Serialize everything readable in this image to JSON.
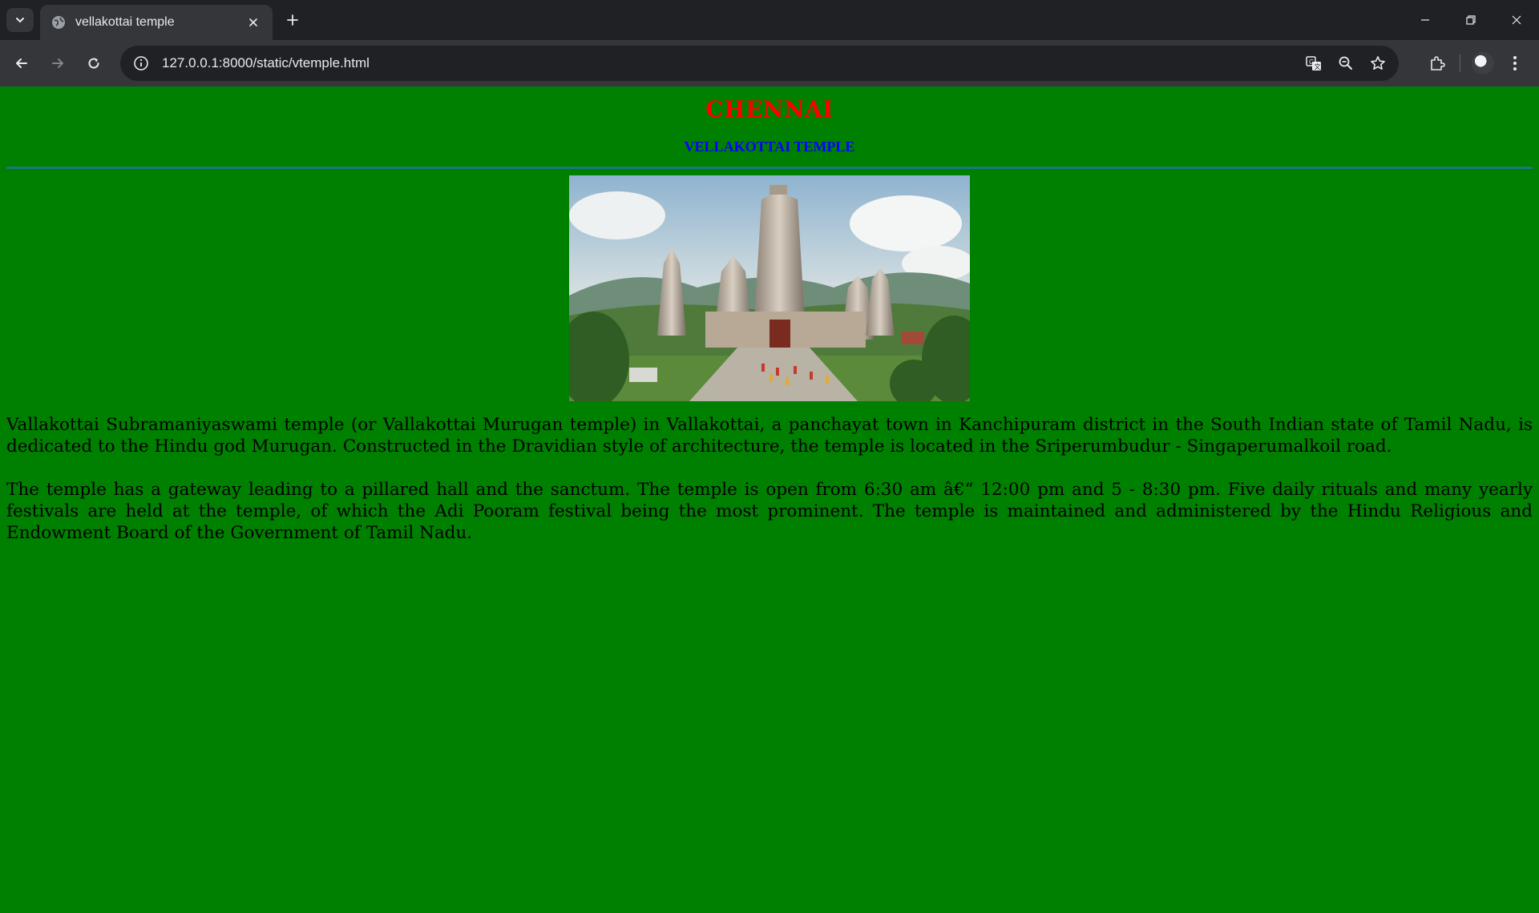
{
  "browser": {
    "tab_title": "vellakottai temple",
    "url": "127.0.0.1:8000/static/vtemple.html"
  },
  "page": {
    "city": "CHENNAI",
    "temple_name": "VELLAKOTTAI TEMPLE",
    "paragraph_1": "Vallakottai Subramaniyaswami temple (or Vallakottai Murugan temple) in Vallakottai, a panchayat town in Kanchipuram district in the South Indian state of Tamil Nadu, is dedicated to the Hindu god Murugan. Constructed in the Dravidian style of architecture, the temple is located in the Sriperumbudur - Singaperumalkoil road.",
    "paragraph_2": "The temple has a gateway leading to a pillared hall and the sanctum. The temple is open from 6:30 am â€“ 12:00 pm and 5 - 8:30 pm. Five daily rituals and many yearly festivals are held at the temple, of which the Adi Pooram festival being the most prominent. The temple is maintained and administered by the Hindu Religious and Endowment Board of the Government of Tamil Nadu.",
    "colors": {
      "background": "#008000",
      "city_heading": "#ff0000",
      "temple_heading": "#0000ff"
    }
  },
  "icons": {
    "tab_search": "chevron-down-icon",
    "favicon": "globe-icon",
    "tab_close": "close-icon",
    "new_tab": "plus-icon",
    "back": "back-arrow-icon",
    "forward": "forward-arrow-icon",
    "reload": "reload-icon",
    "site_info": "info-icon",
    "translate": "translate-icon",
    "zoom": "zoom-out-icon",
    "bookmark": "star-icon",
    "extensions": "puzzle-icon",
    "menu": "kebab-menu-icon"
  }
}
